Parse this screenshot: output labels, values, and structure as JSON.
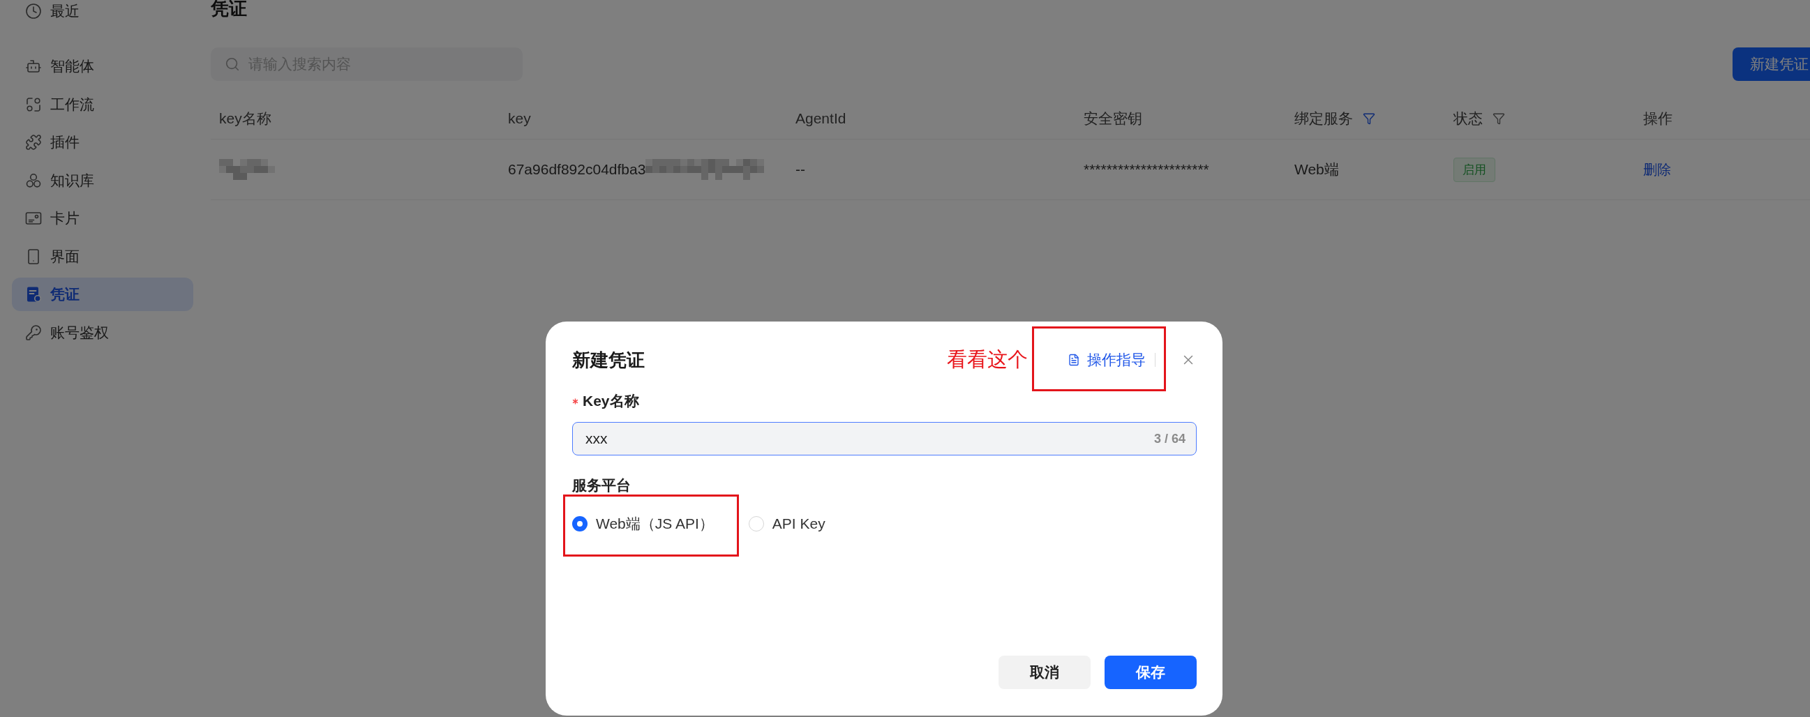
{
  "sidebar": {
    "groups": [
      {
        "items": [
          {
            "label": "最近",
            "selected": false
          }
        ]
      },
      {
        "items": [
          {
            "label": "智能体",
            "selected": false
          },
          {
            "label": "工作流",
            "selected": false
          },
          {
            "label": "插件",
            "selected": false
          },
          {
            "label": "知识库",
            "selected": false
          },
          {
            "label": "卡片",
            "selected": false
          },
          {
            "label": "界面",
            "selected": false
          },
          {
            "label": "凭证",
            "selected": true
          },
          {
            "label": "账号鉴权",
            "selected": false
          }
        ]
      }
    ]
  },
  "page": {
    "title": "凭证",
    "search": {
      "placeholder": "请输入搜索内容"
    },
    "new_button": "新建凭证"
  },
  "table": {
    "columns": [
      {
        "label": "key名称",
        "kind": "plain"
      },
      {
        "label": "key",
        "kind": "plain"
      },
      {
        "label": "AgentId",
        "kind": "plain"
      },
      {
        "label": "安全密钥",
        "kind": "plain"
      },
      {
        "label": "绑定服务",
        "kind": "filter",
        "filter_active": true
      },
      {
        "label": "状态",
        "kind": "filter",
        "filter_active": false
      },
      {
        "label": "操作",
        "kind": "plain"
      }
    ],
    "rows": [
      {
        "cells": [
          {
            "kind": "text",
            "redacted": true
          },
          {
            "kind": "text",
            "text": "67a96df892c04dfba3",
            "redacted": true
          },
          {
            "kind": "text",
            "text": "--",
            "redacted": false
          },
          {
            "kind": "text",
            "text": "**********************",
            "redacted": false
          },
          {
            "kind": "text",
            "text": "Web端",
            "redacted": false
          },
          {
            "kind": "tag",
            "text": "启用",
            "redacted": false
          },
          {
            "kind": "link",
            "text": "删除",
            "redacted": false
          }
        ]
      }
    ]
  },
  "dialog": {
    "title": "新建凭证",
    "note": "看看这个",
    "guide_link": {
      "label": "操作指导",
      "highlighted": true
    },
    "field": {
      "label": "Key名称",
      "required": true,
      "value": "xxx",
      "counter": "3 / 64",
      "focused": true
    },
    "platform": {
      "label": "服务平台",
      "options": [
        {
          "label": "Web端（JS API）",
          "selected": true,
          "highlighted": true
        },
        {
          "label": "API Key",
          "selected": false,
          "highlighted": false
        }
      ]
    },
    "buttons": [
      {
        "label": "取消",
        "kind": "secondary"
      },
      {
        "label": "保存",
        "kind": "primary"
      }
    ]
  }
}
